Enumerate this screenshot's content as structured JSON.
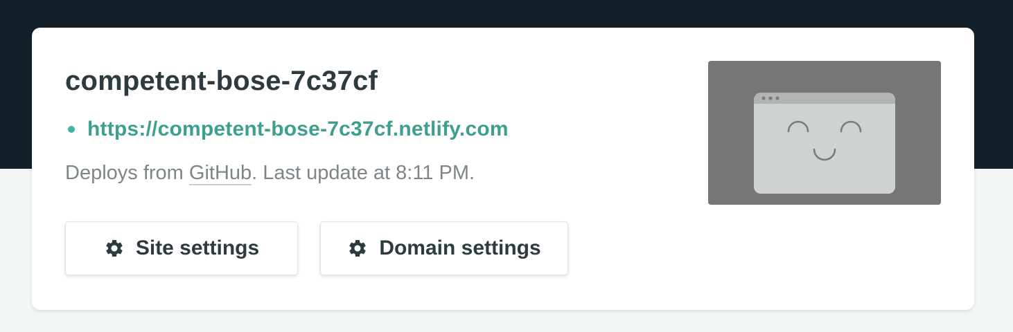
{
  "site": {
    "name": "competent-bose-7c37cf",
    "url": "https://competent-bose-7c37cf.netlify.com",
    "deploy_prefix": "Deploys from ",
    "deploy_provider": "GitHub",
    "deploy_suffix": ". Last update at 8:11 PM."
  },
  "actions": {
    "site_settings_label": "Site settings",
    "domain_settings_label": "Domain settings"
  },
  "preview": {
    "icon": "smiley-browser-placeholder-icon"
  },
  "icons": {
    "settings": "gear-icon",
    "status": "status-dot"
  },
  "colors": {
    "header_bg": "#14202a",
    "page_bg": "#f3f6f7",
    "card_bg": "#ffffff",
    "title": "#2d3b41",
    "url": "#3e9e8f",
    "status_dot": "#3fb5a0",
    "muted_text": "#7d8589",
    "preview_bg": "#767677"
  }
}
